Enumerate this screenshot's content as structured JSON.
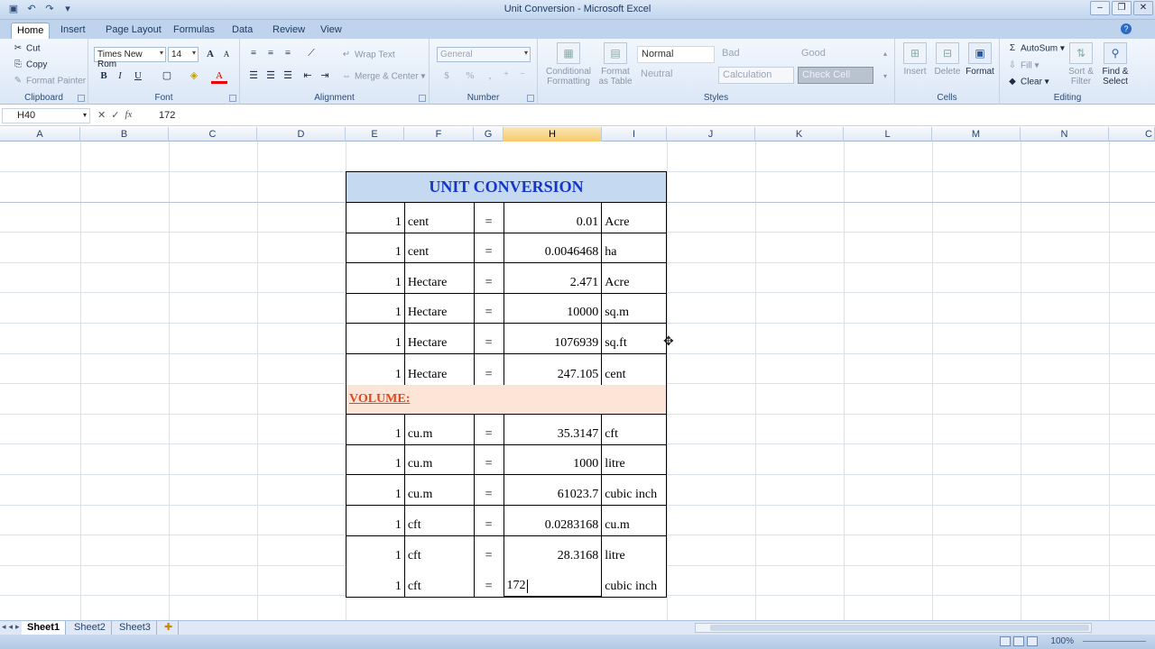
{
  "window": {
    "title": "Unit Conversion - Microsoft Excel"
  },
  "tabs": [
    "Home",
    "Insert",
    "Page Layout",
    "Formulas",
    "Data",
    "Review",
    "View"
  ],
  "ribbon": {
    "clipboard": {
      "label": "Clipboard",
      "cut": "Cut",
      "copy": "Copy",
      "format_painter": "Format Painter"
    },
    "font": {
      "label": "Font",
      "family": "Times New Rom",
      "size": "14",
      "bold": "B",
      "italic": "I",
      "underline": "U",
      "grow": "A",
      "shrink": "A",
      "font_color_letter": "A"
    },
    "alignment": {
      "label": "Alignment",
      "wrap_text": "Wrap Text",
      "merge_center": "Merge & Center"
    },
    "number": {
      "label": "Number",
      "format": "General",
      "percent": "%"
    },
    "styles": {
      "label": "Styles",
      "conditional_formatting": "Conditional Formatting",
      "format_as_table": "Format as Table",
      "cells": [
        "Normal",
        "Bad",
        "Good",
        "Neutral",
        "Calculation",
        "Check Cell"
      ]
    },
    "cells": {
      "label": "Cells",
      "insert": "Insert",
      "delete": "Delete",
      "format": "Format"
    },
    "editing": {
      "label": "Editing",
      "autosum": "AutoSum",
      "fill": "Fill",
      "clear": "Clear",
      "sort_filter": "Sort & Filter",
      "find_select": "Find & Select"
    }
  },
  "formula_bar": {
    "name_box": "H40",
    "cancel": "✕",
    "enter": "✓",
    "fx": "fx",
    "value": "172"
  },
  "columns": [
    "A",
    "B",
    "C",
    "D",
    "E",
    "F",
    "G",
    "H",
    "I",
    "J",
    "K",
    "L",
    "M",
    "N",
    "C"
  ],
  "table": {
    "title": "UNIT CONVERSION",
    "rows_area": [
      [
        "1",
        "cent",
        "=",
        "0.01",
        "Acre"
      ],
      [
        "1",
        "cent",
        "=",
        "0.0046468",
        "ha"
      ],
      [
        "1",
        "Hectare",
        "=",
        "2.471",
        "Acre"
      ],
      [
        "1",
        "Hectare",
        "=",
        "10000",
        "sq.m"
      ],
      [
        "1",
        "Hectare",
        "=",
        "1076939",
        "sq.ft"
      ],
      [
        "1",
        "Hectare",
        "=",
        "247.105",
        "cent"
      ]
    ],
    "section": "VOLUME:",
    "rows_volume": [
      [
        "1",
        "cu.m",
        "=",
        "35.3147",
        "cft"
      ],
      [
        "1",
        "cu.m",
        "=",
        "1000",
        "litre"
      ],
      [
        "1",
        "cu.m",
        "=",
        "61023.7",
        "cubic inch"
      ],
      [
        "1",
        "cft",
        "=",
        "0.0283168",
        "cu.m"
      ],
      [
        "1",
        "cft",
        "=",
        "28.3168",
        "litre"
      ]
    ],
    "editing_row": [
      "1",
      "cft",
      "=",
      "172",
      "cubic inch"
    ]
  },
  "sheets": [
    "Sheet1",
    "Sheet2",
    "Sheet3"
  ],
  "status": {
    "zoom": "100%"
  },
  "colors": {
    "title_fill": "#c5d9f1",
    "title_text": "#1336c9",
    "section_fill": "#fce4d6",
    "section_text": "#e2471b",
    "selected_col": "#f8c96c"
  }
}
